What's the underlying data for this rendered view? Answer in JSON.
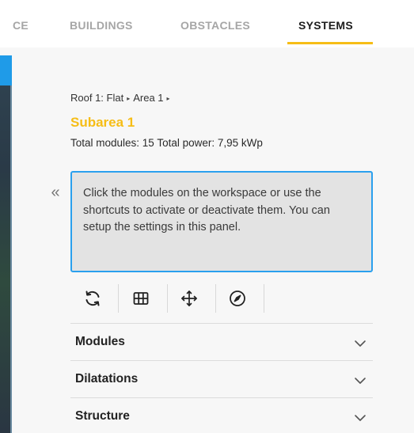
{
  "tabs": [
    {
      "label": "CE",
      "active": false
    },
    {
      "label": "BUILDINGS",
      "active": false
    },
    {
      "label": "OBSTACLES",
      "active": false
    },
    {
      "label": "SYSTEMS",
      "active": true
    }
  ],
  "accent_color": "#f6bd16",
  "info_border_color": "#2aa0ee",
  "breadcrumb": {
    "roof": "Roof 1: Flat",
    "area": "Area 1",
    "separator": "▸"
  },
  "subarea": {
    "title": "Subarea 1",
    "summary": "Total modules: 15 Total power: 7,95 kWp"
  },
  "collapse_icon": "double-chevron-left-icon",
  "collapse_glyph": "«",
  "info_text": "Click the modules on the workspace or use the shortcuts to activate or deactivate them. You can setup the settings in this panel.",
  "toolbar_icons": [
    "refresh-icon",
    "grid-icon",
    "move-icon",
    "compass-icon"
  ],
  "sections": [
    {
      "label": "Modules"
    },
    {
      "label": "Dilatations"
    },
    {
      "label": "Structure"
    }
  ]
}
